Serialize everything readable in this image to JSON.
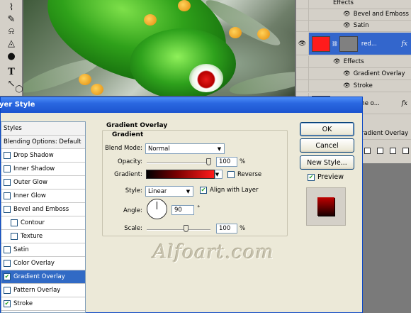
{
  "canvas": {
    "description_icon": "frog-photo"
  },
  "tools": [
    "lasso-icon",
    "brush-icon",
    "stamp-icon",
    "bucket-icon",
    "dodge-icon",
    "type-icon",
    "pen-icon",
    "ellipse-icon"
  ],
  "layers": {
    "rows": [
      {
        "kind": "effects",
        "label": "Effects"
      },
      {
        "kind": "effect",
        "label": "Bevel and Emboss"
      },
      {
        "kind": "effect",
        "label": "Satin"
      },
      {
        "kind": "layer",
        "label": "red...",
        "fx": "fx",
        "selected": true
      },
      {
        "kind": "effects",
        "label": "Effects"
      },
      {
        "kind": "effect",
        "label": "Gradient Overlay"
      },
      {
        "kind": "effect",
        "label": "Stroke"
      },
      {
        "kind": "layer",
        "label": "the o...",
        "fx": "fx"
      },
      {
        "kind": "effect",
        "label": "radient Overlay"
      }
    ]
  },
  "dialog": {
    "title": "yer Style",
    "styles_header": "Styles",
    "blending_header": "Blending Options: Default",
    "style_items": [
      {
        "label": "Drop Shadow",
        "checked": false
      },
      {
        "label": "Inner Shadow",
        "checked": false
      },
      {
        "label": "Outer Glow",
        "checked": false
      },
      {
        "label": "Inner Glow",
        "checked": false
      },
      {
        "label": "Bevel and Emboss",
        "checked": false
      },
      {
        "label": "Contour",
        "checked": false,
        "sub": true
      },
      {
        "label": "Texture",
        "checked": false,
        "sub": true
      },
      {
        "label": "Satin",
        "checked": false
      },
      {
        "label": "Color Overlay",
        "checked": false
      },
      {
        "label": "Gradient Overlay",
        "checked": true,
        "selected": true
      },
      {
        "label": "Pattern Overlay",
        "checked": false
      },
      {
        "label": "Stroke",
        "checked": true
      }
    ],
    "panel_title": "Gradient Overlay",
    "group_title": "Gradient",
    "blend_mode_label": "Blend Mode:",
    "blend_mode_value": "Normal",
    "opacity_label": "Opacity:",
    "opacity_value": "100",
    "opacity_unit": "%",
    "gradient_label": "Gradient:",
    "reverse_label": "Reverse",
    "reverse_checked": false,
    "style_label": "Style:",
    "style_value": "Linear",
    "align_label": "Align with Layer",
    "align_checked": true,
    "angle_label": "Angle:",
    "angle_value": "90",
    "angle_unit": "°",
    "scale_label": "Scale:",
    "scale_value": "100",
    "scale_unit": "%",
    "ok_label": "OK",
    "cancel_label": "Cancel",
    "new_style_label": "New Style...",
    "preview_label": "Preview",
    "preview_checked": true
  },
  "watermark": "Alfoart.com",
  "colors": {
    "title_bar": "#2a67e0",
    "selection": "#316ac5",
    "layer_selected_swatch": "#ff1b1b"
  }
}
